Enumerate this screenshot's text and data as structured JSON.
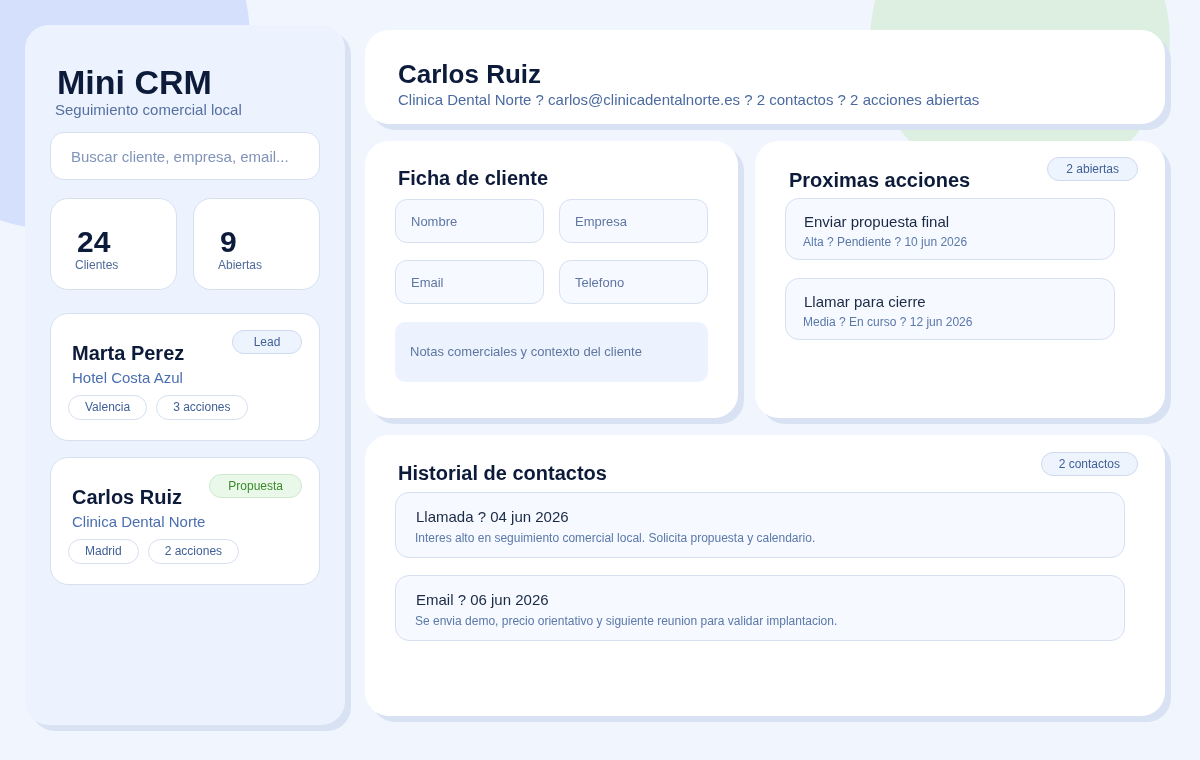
{
  "sidebar": {
    "title": "Mini CRM",
    "subtitle": "Seguimiento comercial local",
    "search": {
      "placeholder": "Buscar cliente, empresa, email..."
    },
    "stats": [
      {
        "value": "24",
        "label": "Clientes"
      },
      {
        "value": "9",
        "label": "Abiertas"
      }
    ],
    "clients": [
      {
        "name": "Marta Perez",
        "company": "Hotel Costa Azul",
        "stage": {
          "label": "Lead",
          "kind": "lead"
        },
        "tags": [
          "Valencia",
          "3 acciones"
        ]
      },
      {
        "name": "Carlos Ruiz",
        "company": "Clinica Dental Norte",
        "stage": {
          "label": "Propuesta",
          "kind": "proposal"
        },
        "tags": [
          "Madrid",
          "2 acciones"
        ]
      }
    ]
  },
  "header": {
    "name": "Carlos Ruiz",
    "details": "Clinica Dental Norte ? carlos@clinicadentalnorte.es ? 2 contactos ? 2 acciones abiertas"
  },
  "client_form": {
    "title": "Ficha de cliente",
    "fields": [
      {
        "placeholder": "Nombre"
      },
      {
        "placeholder": "Empresa"
      },
      {
        "placeholder": "Email"
      },
      {
        "placeholder": "Telefono"
      }
    ],
    "notes": {
      "placeholder": "Notas comerciales y contexto del cliente"
    }
  },
  "next_actions": {
    "title": "Proximas acciones",
    "badge": "2 abiertas",
    "items": [
      {
        "title": "Enviar propuesta final",
        "meta": "Alta ? Pendiente ? 10 jun 2026"
      },
      {
        "title": "Llamar para cierre",
        "meta": "Media ? En curso ? 12 jun 2026"
      }
    ]
  },
  "contact_history": {
    "title": "Historial de contactos",
    "badge": "2 contactos",
    "items": [
      {
        "title": "Llamada ? 04 jun 2026",
        "note": "Interes alto en seguimiento comercial local. Solicita propuesta y calendario."
      },
      {
        "title": "Email ? 06 jun 2026",
        "note": "Se envia demo, precio orientativo y siguiente reunion para validar implantacion."
      }
    ]
  }
}
